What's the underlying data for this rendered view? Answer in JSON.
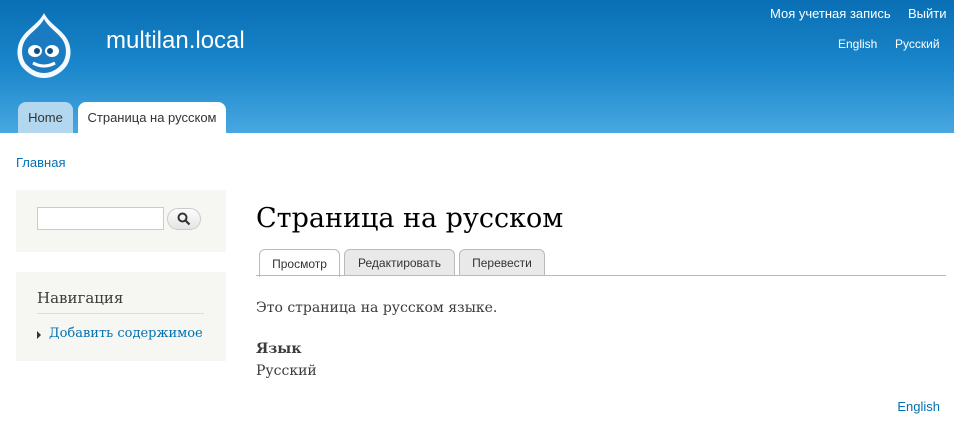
{
  "header": {
    "site_name": "multilan.local",
    "user_links": {
      "account": "Моя учетная запись",
      "logout": "Выйти"
    },
    "language_switcher": {
      "english": "English",
      "russian": "Русский"
    }
  },
  "main_menu": {
    "tabs": [
      {
        "label": "Home",
        "active": false
      },
      {
        "label": "Страница на русском",
        "active": true
      }
    ]
  },
  "breadcrumb": {
    "home": "Главная"
  },
  "sidebar": {
    "search": {
      "value": "",
      "icon": "search-icon"
    },
    "navigation": {
      "title": "Навигация",
      "items": [
        {
          "label": "Добавить содержимое"
        }
      ]
    }
  },
  "content": {
    "title": "Страница на русском",
    "local_tabs": [
      {
        "label": "Просмотр",
        "active": true
      },
      {
        "label": "Редактировать",
        "active": false
      },
      {
        "label": "Перевести",
        "active": false
      }
    ],
    "body": "Это страница на русском языке.",
    "field": {
      "label": "Язык",
      "value": "Русский"
    },
    "language_link": "English"
  },
  "colors": {
    "header_top": "#0a6fb4",
    "header_bottom": "#48a7e0",
    "link": "#0071b3",
    "sidebar_bg": "#f6f6f2"
  }
}
